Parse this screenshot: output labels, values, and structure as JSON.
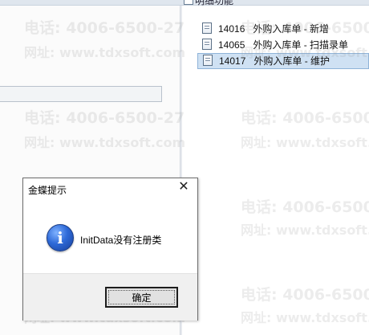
{
  "header": {
    "title": "明细功能"
  },
  "tree": {
    "items": [
      {
        "code": "14016",
        "label": "外购入库单 - 新增",
        "selected": false
      },
      {
        "code": "14065",
        "label": "外购入库单 - 扫描录单",
        "selected": false
      },
      {
        "code": "14017",
        "label": "外购入库单 - 维护",
        "selected": true
      }
    ]
  },
  "watermark": {
    "phone": "电话: 4006-6500-27",
    "url": "网址: www.tdxsoft.com"
  },
  "dialog": {
    "title": "金蝶提示",
    "close_glyph": "✕",
    "icon_glyph": "i",
    "message": "InitData没有注册类",
    "ok_label": "确定"
  },
  "colors": {
    "selection_bg": "#cfe1f3",
    "info_icon": "#2e6ad8"
  }
}
